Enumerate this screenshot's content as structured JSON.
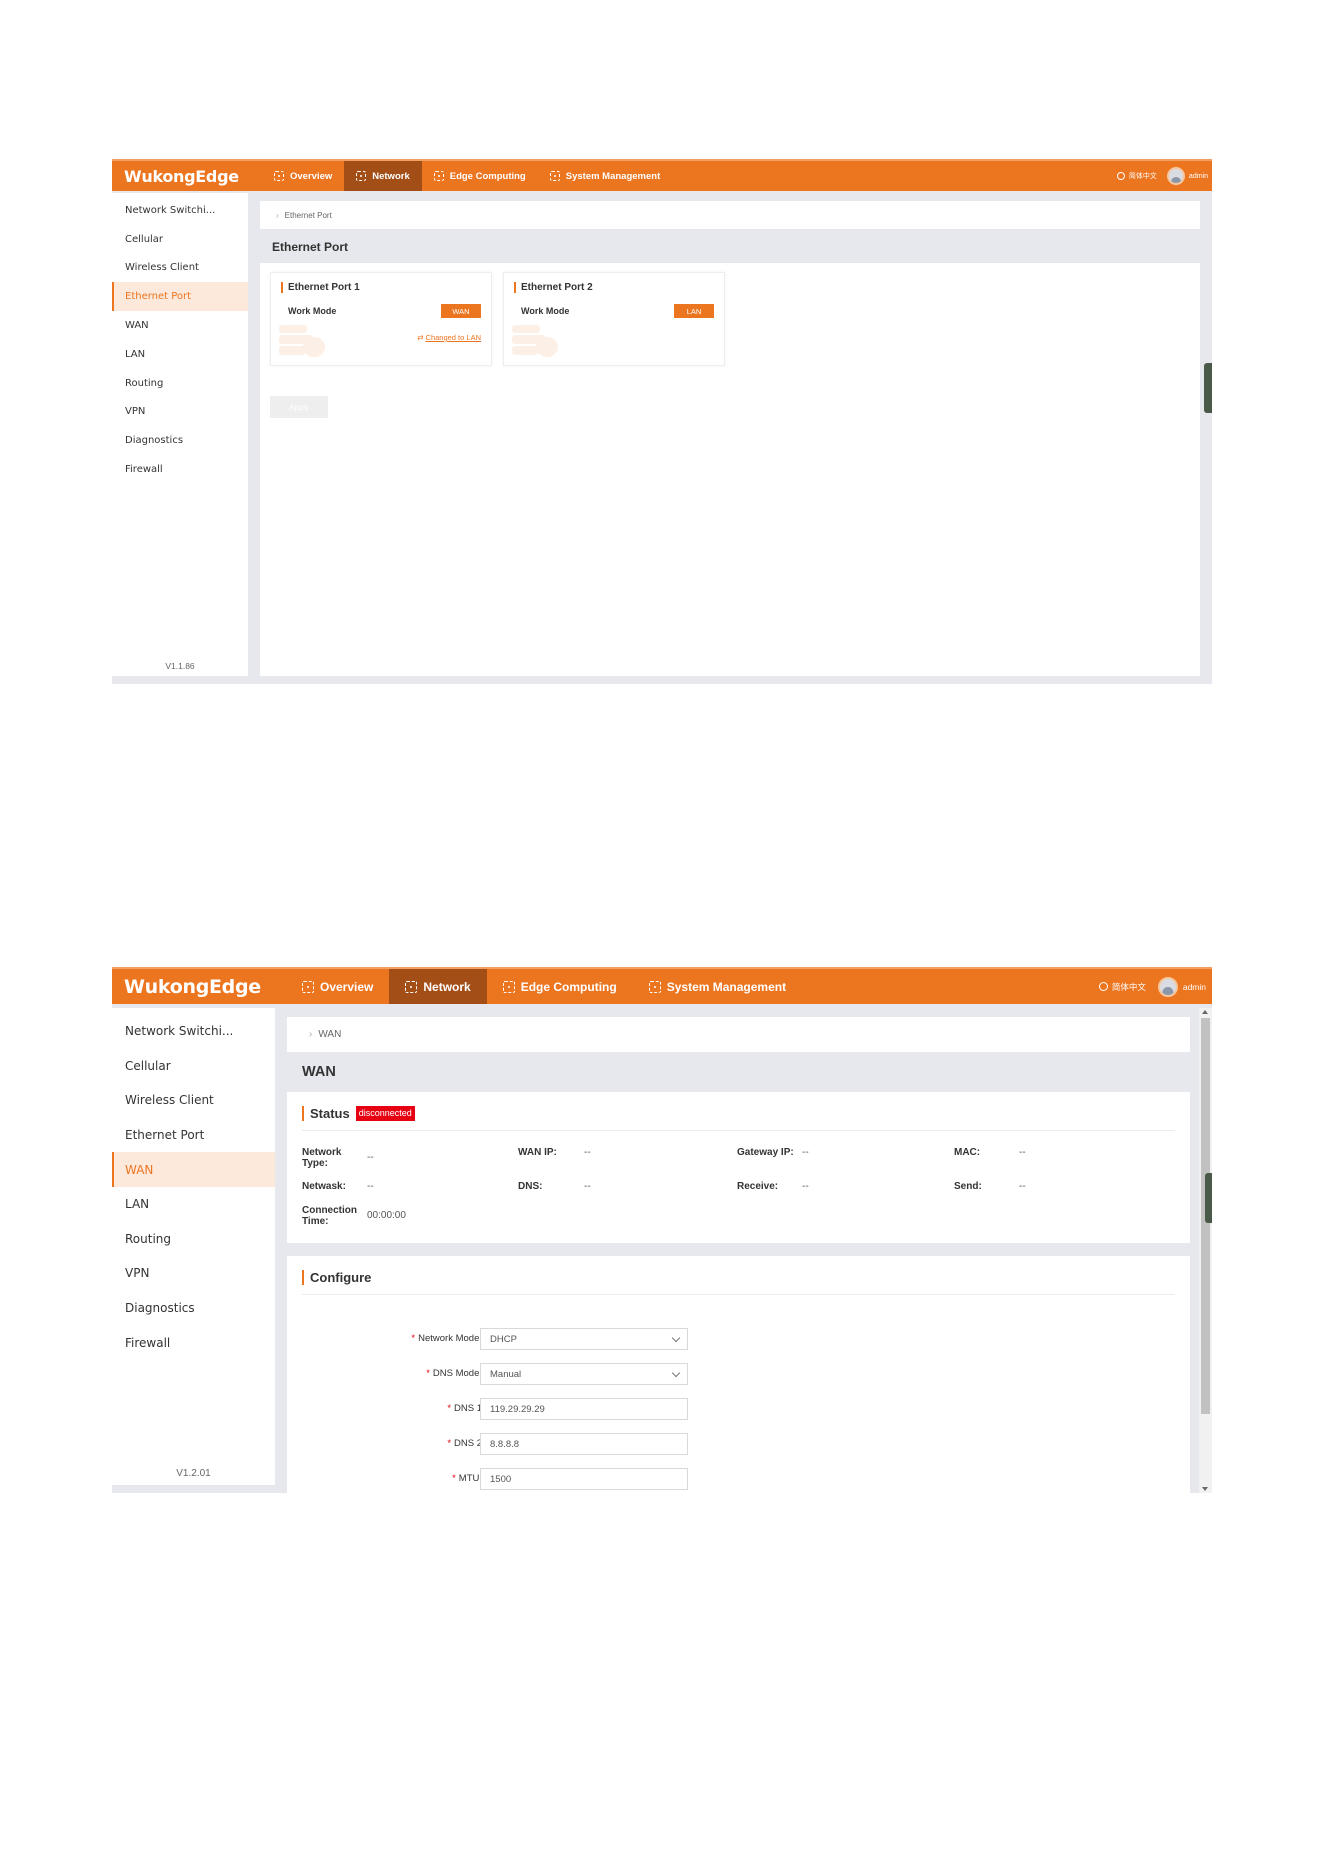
{
  "app": {
    "logo": "WukongEdge",
    "nav_tabs": [
      {
        "label": "Overview"
      },
      {
        "label": "Network"
      },
      {
        "label": "Edge Computing"
      },
      {
        "label": "System Management"
      }
    ],
    "language": "简体中文",
    "user": "admin"
  },
  "sidebar": {
    "items": [
      {
        "label": "Network Switchi..."
      },
      {
        "label": "Cellular"
      },
      {
        "label": "Wireless Client"
      },
      {
        "label": "Ethernet Port"
      },
      {
        "label": "WAN"
      },
      {
        "label": "LAN"
      },
      {
        "label": "Routing"
      },
      {
        "label": "VPN"
      },
      {
        "label": "Diagnostics"
      },
      {
        "label": "Firewall"
      }
    ]
  },
  "screen1": {
    "active_nav": "Network",
    "active_sidebar": "Ethernet Port",
    "version": "V1.1.86",
    "breadcrumb": "Ethernet Port",
    "title": "Ethernet Port",
    "ports": [
      {
        "title": "Ethernet Port 1",
        "work_mode_label": "Work Mode",
        "mode": "WAN",
        "change_link": "Changed to LAN"
      },
      {
        "title": "Ethernet Port 2",
        "work_mode_label": "Work Mode",
        "mode": "LAN"
      }
    ],
    "apply_label": "Apply"
  },
  "screen2": {
    "active_nav": "Network",
    "active_sidebar": "WAN",
    "version": "V1.2.01",
    "breadcrumb": "WAN",
    "title": "WAN",
    "status": {
      "title": "Status",
      "badge": "disconnected",
      "fields": {
        "network_type": {
          "label": "Network Type:",
          "value": "--"
        },
        "wan_ip": {
          "label": "WAN IP:",
          "value": "--"
        },
        "gateway_ip": {
          "label": "Gateway IP:",
          "value": "--"
        },
        "mac": {
          "label": "MAC:",
          "value": "--"
        },
        "netmask": {
          "label": "Netwask:",
          "value": "--"
        },
        "dns": {
          "label": "DNS:",
          "value": "--"
        },
        "receive": {
          "label": "Receive:",
          "value": "--"
        },
        "send": {
          "label": "Send:",
          "value": "--"
        },
        "connection_time": {
          "label": "Connection Time:",
          "value": "00:00:00"
        }
      }
    },
    "configure": {
      "title": "Configure",
      "fields": [
        {
          "label": "Network Mode:",
          "value": "DHCP",
          "required": "*"
        },
        {
          "label": "DNS Mode:",
          "value": "Manual",
          "required": "*"
        },
        {
          "label": "DNS 1",
          "value": "119.29.29.29",
          "required": "*"
        },
        {
          "label": "DNS 2",
          "value": "8.8.8.8",
          "required": "*"
        },
        {
          "label": "MTU:",
          "value": "1500",
          "required": "*"
        }
      ]
    }
  },
  "colors": {
    "brand": "#ec7520",
    "active_tab": "#a44e17",
    "sidebar_active_bg": "#fce9dc",
    "status_error": "#e60012"
  }
}
